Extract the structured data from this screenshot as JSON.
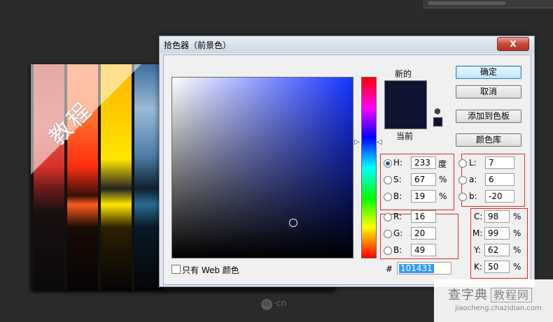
{
  "background": {
    "title_text": "教程",
    "watermark_text": "·cn",
    "watermark_logo": "Ui",
    "site_name": "查字典",
    "site_tag": "教程网",
    "site_url": "jiaocheng.chazidian.com"
  },
  "dialog": {
    "title": "拾色器（前景色）",
    "close_label": "X",
    "new_label": "新的",
    "current_label": "当前",
    "new_color": "#101431",
    "current_color": "#101431",
    "buttons": {
      "ok": "确定",
      "cancel": "取消",
      "add_swatch": "添加到色板",
      "libraries": "颜色库"
    },
    "hsb": {
      "h_label": "H:",
      "h_value": "233",
      "h_unit": "度",
      "s_label": "S:",
      "s_value": "67",
      "s_unit": "%",
      "b_label": "B:",
      "b_value": "19",
      "b_unit": "%"
    },
    "rgb": {
      "r_label": "R:",
      "r_value": "16",
      "g_label": "G:",
      "g_value": "20",
      "b_label": "B:",
      "b_value": "49"
    },
    "lab": {
      "l_label": "L:",
      "l_value": "7",
      "a_label": "a:",
      "a_value": "6",
      "b_label": "b:",
      "b_value": "-20"
    },
    "cmyk": {
      "c_label": "C:",
      "c_value": "98",
      "m_label": "M:",
      "m_value": "99",
      "y_label": "Y:",
      "y_value": "62",
      "k_label": "K:",
      "k_value": "50",
      "unit": "%"
    },
    "web_only_label": "只有 Web 颜色",
    "hash_label": "#",
    "hex_value": "101431",
    "hue_field_color": "#1433ff"
  }
}
